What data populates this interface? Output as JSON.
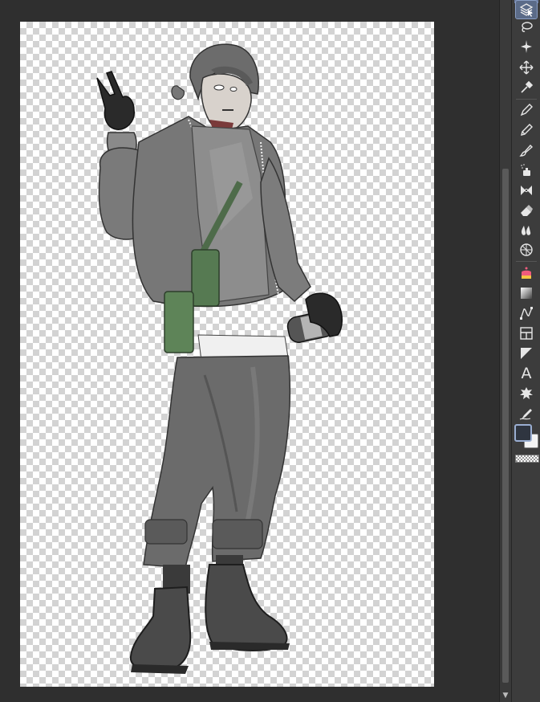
{
  "window": {
    "app": "clip-studio-paint"
  },
  "canvas": {
    "background": "transparent-checkerboard",
    "subject": "character-illustration"
  },
  "colors": {
    "workspace": "#2f2f2f",
    "toolbar": "#3c3c3c",
    "active_tool": "#5b6b88",
    "foreground": "#2f3540",
    "background": "#f4f4f4"
  },
  "toolbar": {
    "tools": [
      {
        "id": "operation",
        "icon": "cursor-object-icon",
        "active": true
      },
      {
        "id": "lasso",
        "icon": "lasso-icon"
      },
      {
        "id": "magic-wand",
        "icon": "magic-wand-icon"
      },
      {
        "id": "move",
        "icon": "move-icon"
      },
      {
        "id": "eyedropper",
        "icon": "eyedropper-icon"
      },
      {
        "id": "pen",
        "icon": "pen-icon"
      },
      {
        "id": "pencil",
        "icon": "pencil-icon"
      },
      {
        "id": "brush",
        "icon": "brush-icon"
      },
      {
        "id": "airbrush",
        "icon": "airbrush-icon"
      },
      {
        "id": "decoration",
        "icon": "decoration-icon"
      },
      {
        "id": "eraser",
        "icon": "eraser-icon"
      },
      {
        "id": "blend",
        "icon": "blend-icon"
      },
      {
        "id": "fill",
        "icon": "fill-icon"
      },
      {
        "id": "gradient-cake",
        "icon": "cake-icon"
      },
      {
        "id": "gradient",
        "icon": "gradient-icon"
      },
      {
        "id": "figure",
        "icon": "curve-icon"
      },
      {
        "id": "frame-border",
        "icon": "frame-icon"
      },
      {
        "id": "ruler",
        "icon": "ruler-icon"
      },
      {
        "id": "text",
        "icon": "text-icon",
        "label": "A"
      },
      {
        "id": "balloon",
        "icon": "balloon-icon"
      },
      {
        "id": "correct-line",
        "icon": "correct-line-icon"
      }
    ]
  }
}
